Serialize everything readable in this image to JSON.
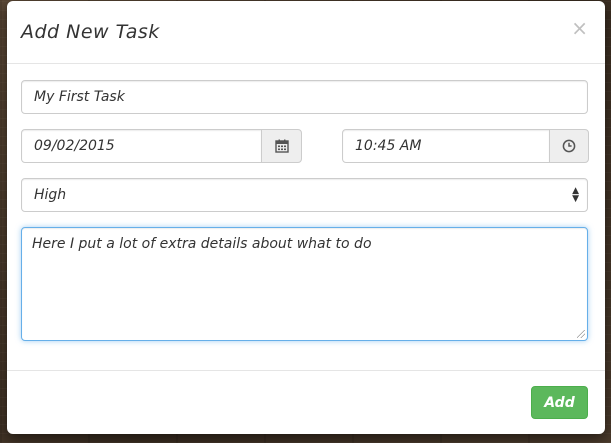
{
  "modal": {
    "title": "Add New Task",
    "close_glyph": "×"
  },
  "form": {
    "task_name": "My First Task",
    "date": "09/02/2015",
    "time": "10:45 AM",
    "priority": "High",
    "details": "Here I put a lot of extra details about what to do"
  },
  "icons": {
    "date_addon": "calendar-icon",
    "time_addon": "clock-icon",
    "close": "close-icon"
  },
  "footer": {
    "add_label": "Add"
  },
  "colors": {
    "add_button": "#5cb85c",
    "focus_border": "#66afe9"
  }
}
